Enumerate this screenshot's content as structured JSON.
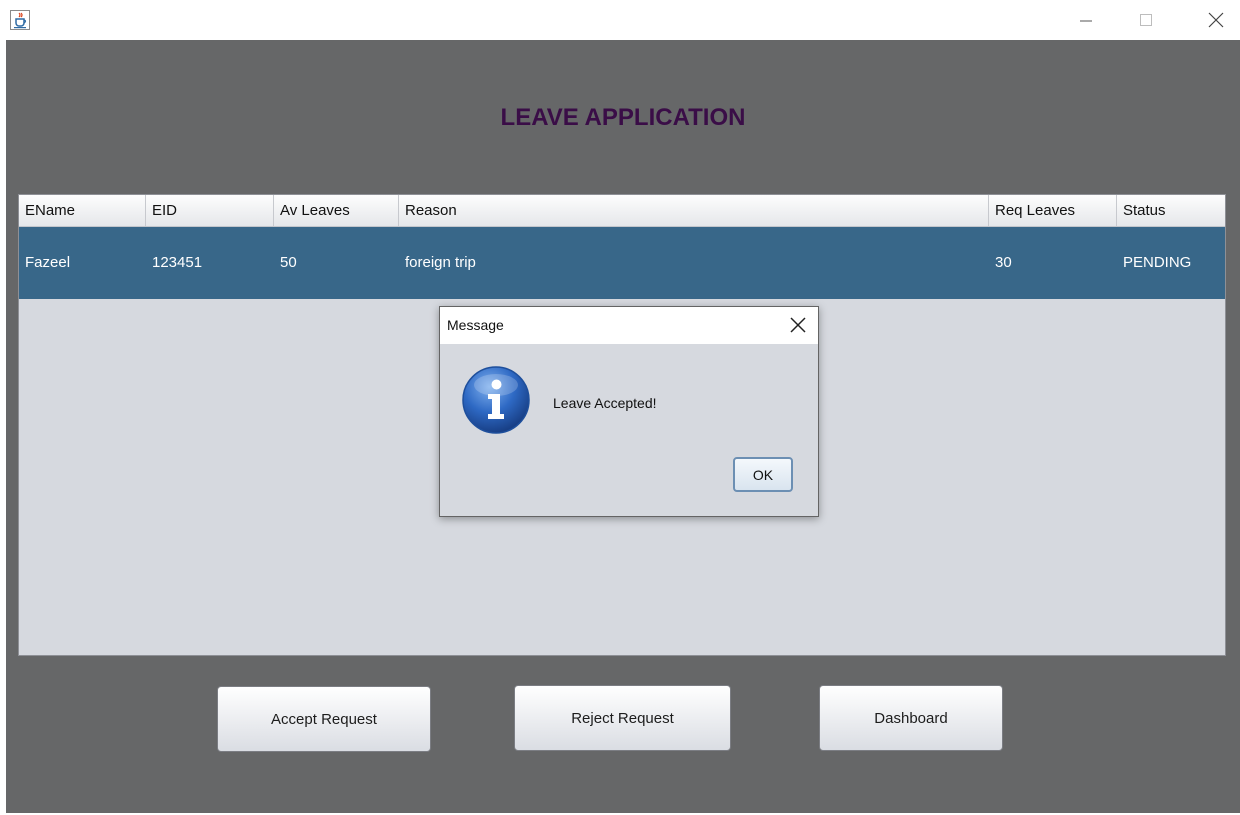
{
  "window": {
    "title": "",
    "icon": "java-cup-icon",
    "controls": {
      "minimize": "minimize-icon",
      "maximize": "maximize-icon",
      "close": "close-icon"
    }
  },
  "page": {
    "title": "LEAVE APPLICATION",
    "title_color": "#3a0d47",
    "background": "#666768"
  },
  "table": {
    "columns": [
      "EName",
      "EID",
      "Av Leaves",
      "Reason",
      "Req Leaves",
      "Status"
    ],
    "rows": [
      {
        "selected": true,
        "cells": [
          "Fazeel",
          "123451",
          "50",
          "foreign trip",
          "30",
          "PENDING"
        ]
      }
    ],
    "selection_color": "#386789"
  },
  "buttons": {
    "accept": "Accept Request",
    "reject": "Reject Request",
    "dashboard": "Dashboard"
  },
  "dialog": {
    "title": "Message",
    "message": "Leave Accepted!",
    "ok": "OK",
    "icon": "information-icon"
  }
}
